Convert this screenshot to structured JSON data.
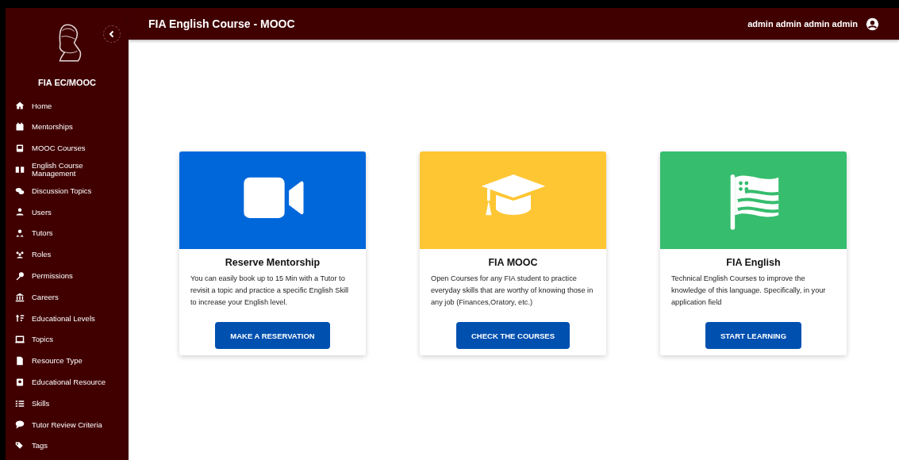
{
  "sidebar": {
    "brand": "FIA EC/MOOC",
    "items": [
      {
        "label": "Home"
      },
      {
        "label": "Mentorships"
      },
      {
        "label": "MOOC Courses"
      },
      {
        "label": "English Course Management"
      },
      {
        "label": "Discussion Topics"
      },
      {
        "label": "Users"
      },
      {
        "label": "Tutors"
      },
      {
        "label": "Roles"
      },
      {
        "label": "Permissions"
      },
      {
        "label": "Careers"
      },
      {
        "label": "Educational Levels"
      },
      {
        "label": "Topics"
      },
      {
        "label": "Resource Type"
      },
      {
        "label": "Educational Resource"
      },
      {
        "label": "Skills"
      },
      {
        "label": "Tutor Review Criteria"
      },
      {
        "label": "Tags"
      }
    ]
  },
  "header": {
    "title": "FIA English Course - MOOC",
    "user": "admin admin admin admin"
  },
  "cards": [
    {
      "title": "Reserve Mentorship",
      "color": "#0067db",
      "text": "You can easily book up to 15 Min with a Tutor to revisit a topic and practice a specific English Skill to increase your English level.",
      "button": "MAKE A RESERVATION"
    },
    {
      "title": "FIA MOOC",
      "color": "#fec633",
      "text": "Open Courses for any FIA student to practice everyday skills that are worthy of knowing those in any job (Finances,Oratory, etc.)",
      "button": "CHECK THE COURSES"
    },
    {
      "title": "FIA English",
      "color": "#36bd6e",
      "text": "Technical English Courses to improve the knowledge of this language. Specifically, in your application field",
      "button": "START LEARNING"
    }
  ]
}
